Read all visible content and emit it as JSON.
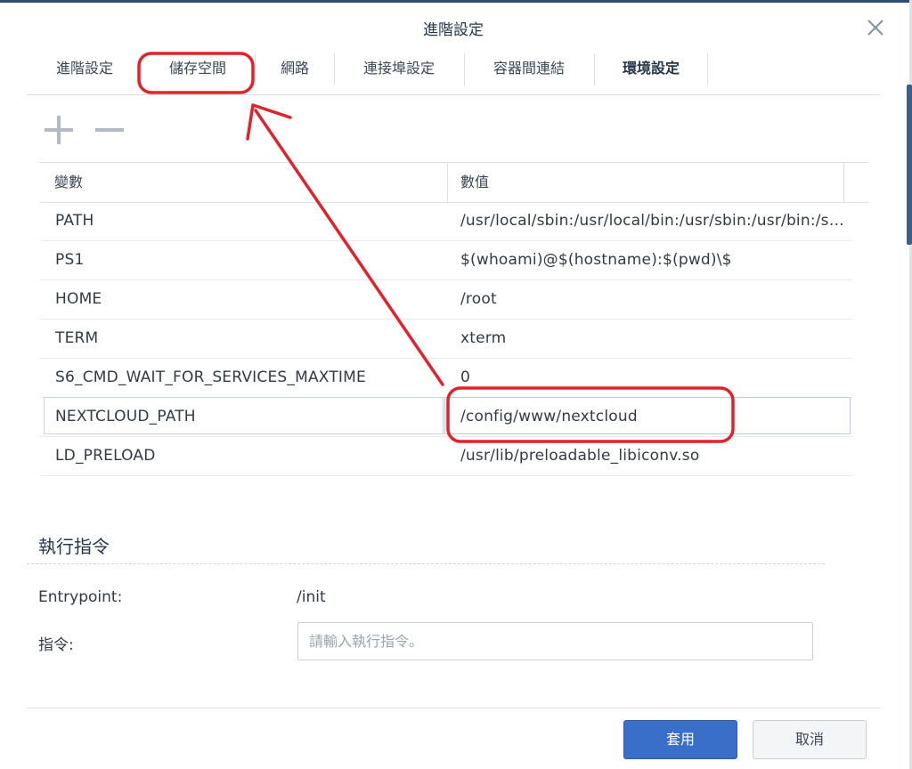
{
  "dialog": {
    "title": "進階設定"
  },
  "tabs": [
    {
      "label": "進階設定"
    },
    {
      "label": "儲存空間"
    },
    {
      "label": "網路"
    },
    {
      "label": "連接埠設定"
    },
    {
      "label": "容器間連結"
    },
    {
      "label": "環境設定"
    }
  ],
  "active_tab": "環境設定",
  "toolbar": {
    "add_icon": "plus-icon",
    "remove_icon": "minus-icon"
  },
  "env_table": {
    "columns": [
      "變數",
      "數值"
    ],
    "rows": [
      {
        "variable": "PATH",
        "value": "/usr/local/sbin:/usr/local/bin:/usr/sbin:/usr/bin:/sbin:/bin"
      },
      {
        "variable": "PS1",
        "value": "$(whoami)@$(hostname):$(pwd)\\$"
      },
      {
        "variable": "HOME",
        "value": "/root"
      },
      {
        "variable": "TERM",
        "value": "xterm"
      },
      {
        "variable": "S6_CMD_WAIT_FOR_SERVICES_MAXTIME",
        "value": "0"
      },
      {
        "variable": "NEXTCLOUD_PATH",
        "value": "/config/www/nextcloud"
      },
      {
        "variable": "LD_PRELOAD",
        "value": "/usr/lib/preloadable_libiconv.so"
      }
    ]
  },
  "exec": {
    "section_title": "執行指令",
    "entrypoint_label": "Entrypoint:",
    "entrypoint_value": "/init",
    "command_label": "指令:",
    "command_placeholder": "請輸入執行指令。",
    "command_value": ""
  },
  "buttons": {
    "apply": "套用",
    "cancel": "取消"
  },
  "colors": {
    "annotation": "#e0222b",
    "primary": "#3a6fc9",
    "title": "#27364a"
  }
}
